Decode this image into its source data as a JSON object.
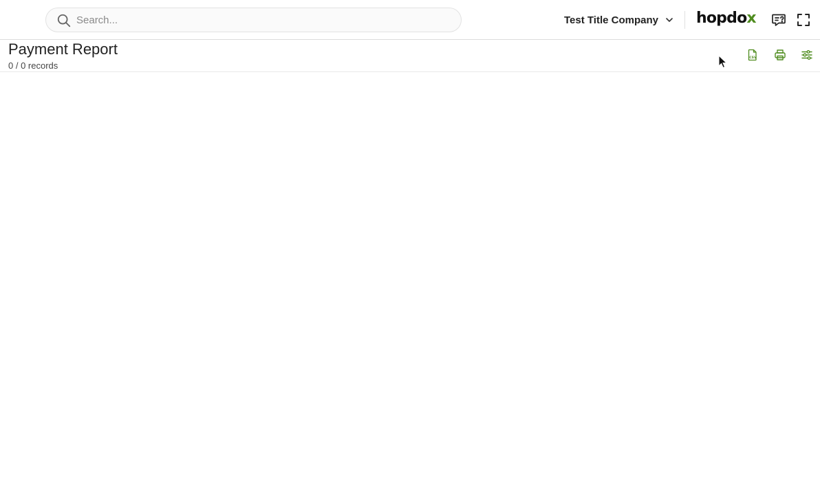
{
  "header": {
    "search": {
      "placeholder": "Search...",
      "value": "",
      "icon": "search-icon"
    },
    "company_selector": {
      "selected": "Test Title Company",
      "icon": "chevron-down-icon"
    },
    "logo": {
      "text_main": "hopdo",
      "text_accent": "x",
      "accent_color": "#4f8c1f"
    },
    "icons": [
      "chat-help-icon",
      "fullscreen-icon"
    ]
  },
  "page": {
    "title": "Payment Report",
    "record_count": "0 / 0 records",
    "actions": [
      "export-csv-icon",
      "print-icon",
      "filter-settings-icon"
    ],
    "action_color": "#4f8c1f"
  }
}
